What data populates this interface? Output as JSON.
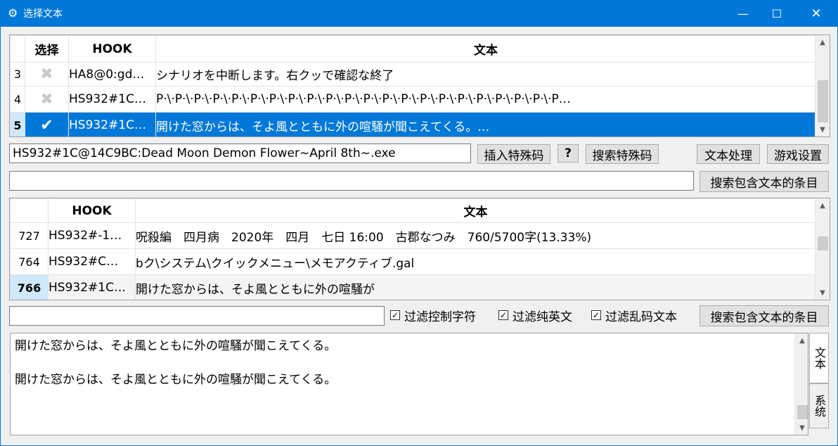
{
  "window": {
    "title": "选择文本",
    "app_icon": "gear-icon"
  },
  "hook_table": {
    "headers": {
      "select": "选择",
      "hook": "HOOK",
      "text": "文本"
    },
    "rows": [
      {
        "num": "3",
        "selected": false,
        "hook": "HA8@0:gd…",
        "text": "シナリオを中断します。右クッで確認な終了"
      },
      {
        "num": "4",
        "selected": false,
        "hook": "HS932#1C…",
        "text": "P·\\·P·\\·P·\\·P·\\·P·\\·P·\\·P·\\·P·\\·P·\\·P·\\·P·\\·P·\\·P·\\·P·\\·P·\\·P·\\·P·\\·P·\\·P·\\·P·\\·P·\\·P…"
      },
      {
        "num": "5",
        "selected": true,
        "hook": "HS932#1C…",
        "text": "開けた窓からは、そよ風とともに外の喧騒が聞こえてくる。…"
      }
    ]
  },
  "toolbar": {
    "hook_code": "HS932#1C@14C9BC:Dead Moon Demon Flower~April 8th~.exe",
    "insert_special": "插入特殊码",
    "help": "?",
    "search_special": "搜索特殊码",
    "text_process": "文本处理",
    "game_settings": "游戏设置"
  },
  "search1": {
    "value": "",
    "button": "搜索包含文本的条目"
  },
  "history_table": {
    "headers": {
      "hook": "HOOK",
      "text": "文本"
    },
    "rows": [
      {
        "num": "727",
        "hook": "HS932#-1…",
        "text": "呪殺編　四月病　2020年　四月　七日 16:00　古郡なつみ　760/5700字(13.33%)"
      },
      {
        "num": "764",
        "hook": "HS932#C…",
        "text": "bク\\システム\\クイックメニュー\\メモアクティブ.gal"
      },
      {
        "num": "766",
        "hook": "HS932#1C…",
        "text": "開けた窓からは、そよ風とともに外の喧騒が"
      }
    ]
  },
  "filters": {
    "value": "",
    "filter_control": "过滤控制字符",
    "filter_english": "过滤纯英文",
    "filter_garbled": "过滤乱码文本",
    "button": "搜索包含文本的条目",
    "checked": [
      "true",
      "true",
      "true"
    ]
  },
  "output": {
    "text": "開けた窓からは、そよ風とともに外の喧騒が聞こえてくる。\n\n開けた窓からは、そよ風とともに外の喧騒が聞こえてくる。",
    "tab_text": "文本",
    "tab_system": "系统"
  },
  "colors": {
    "accent": "#0078d7",
    "check_mark": "#e83a8c"
  }
}
